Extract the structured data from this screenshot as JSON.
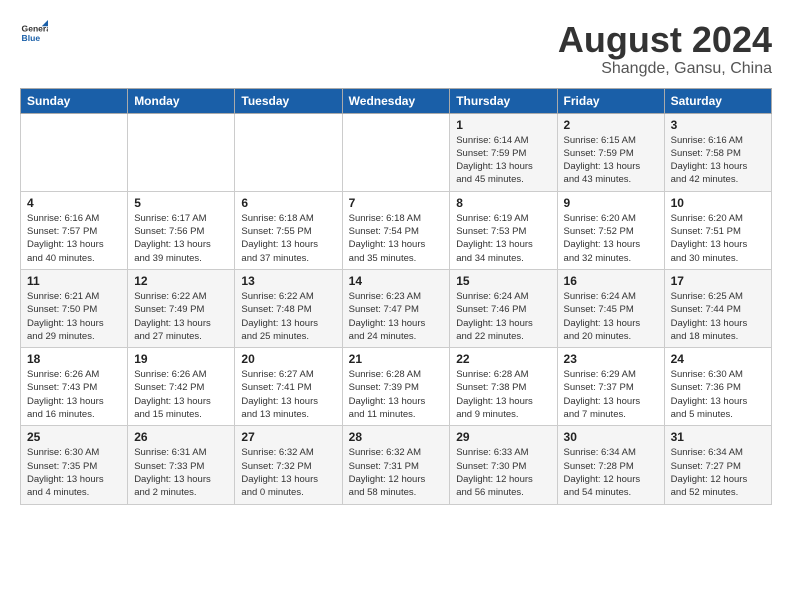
{
  "header": {
    "logo_line1": "General",
    "logo_line2": "Blue",
    "title": "August 2024",
    "subtitle": "Shangde, Gansu, China"
  },
  "days_of_week": [
    "Sunday",
    "Monday",
    "Tuesday",
    "Wednesday",
    "Thursday",
    "Friday",
    "Saturday"
  ],
  "weeks": [
    [
      {
        "day": "",
        "info": ""
      },
      {
        "day": "",
        "info": ""
      },
      {
        "day": "",
        "info": ""
      },
      {
        "day": "",
        "info": ""
      },
      {
        "day": "1",
        "info": "Sunrise: 6:14 AM\nSunset: 7:59 PM\nDaylight: 13 hours\nand 45 minutes."
      },
      {
        "day": "2",
        "info": "Sunrise: 6:15 AM\nSunset: 7:59 PM\nDaylight: 13 hours\nand 43 minutes."
      },
      {
        "day": "3",
        "info": "Sunrise: 6:16 AM\nSunset: 7:58 PM\nDaylight: 13 hours\nand 42 minutes."
      }
    ],
    [
      {
        "day": "4",
        "info": "Sunrise: 6:16 AM\nSunset: 7:57 PM\nDaylight: 13 hours\nand 40 minutes."
      },
      {
        "day": "5",
        "info": "Sunrise: 6:17 AM\nSunset: 7:56 PM\nDaylight: 13 hours\nand 39 minutes."
      },
      {
        "day": "6",
        "info": "Sunrise: 6:18 AM\nSunset: 7:55 PM\nDaylight: 13 hours\nand 37 minutes."
      },
      {
        "day": "7",
        "info": "Sunrise: 6:18 AM\nSunset: 7:54 PM\nDaylight: 13 hours\nand 35 minutes."
      },
      {
        "day": "8",
        "info": "Sunrise: 6:19 AM\nSunset: 7:53 PM\nDaylight: 13 hours\nand 34 minutes."
      },
      {
        "day": "9",
        "info": "Sunrise: 6:20 AM\nSunset: 7:52 PM\nDaylight: 13 hours\nand 32 minutes."
      },
      {
        "day": "10",
        "info": "Sunrise: 6:20 AM\nSunset: 7:51 PM\nDaylight: 13 hours\nand 30 minutes."
      }
    ],
    [
      {
        "day": "11",
        "info": "Sunrise: 6:21 AM\nSunset: 7:50 PM\nDaylight: 13 hours\nand 29 minutes."
      },
      {
        "day": "12",
        "info": "Sunrise: 6:22 AM\nSunset: 7:49 PM\nDaylight: 13 hours\nand 27 minutes."
      },
      {
        "day": "13",
        "info": "Sunrise: 6:22 AM\nSunset: 7:48 PM\nDaylight: 13 hours\nand 25 minutes."
      },
      {
        "day": "14",
        "info": "Sunrise: 6:23 AM\nSunset: 7:47 PM\nDaylight: 13 hours\nand 24 minutes."
      },
      {
        "day": "15",
        "info": "Sunrise: 6:24 AM\nSunset: 7:46 PM\nDaylight: 13 hours\nand 22 minutes."
      },
      {
        "day": "16",
        "info": "Sunrise: 6:24 AM\nSunset: 7:45 PM\nDaylight: 13 hours\nand 20 minutes."
      },
      {
        "day": "17",
        "info": "Sunrise: 6:25 AM\nSunset: 7:44 PM\nDaylight: 13 hours\nand 18 minutes."
      }
    ],
    [
      {
        "day": "18",
        "info": "Sunrise: 6:26 AM\nSunset: 7:43 PM\nDaylight: 13 hours\nand 16 minutes."
      },
      {
        "day": "19",
        "info": "Sunrise: 6:26 AM\nSunset: 7:42 PM\nDaylight: 13 hours\nand 15 minutes."
      },
      {
        "day": "20",
        "info": "Sunrise: 6:27 AM\nSunset: 7:41 PM\nDaylight: 13 hours\nand 13 minutes."
      },
      {
        "day": "21",
        "info": "Sunrise: 6:28 AM\nSunset: 7:39 PM\nDaylight: 13 hours\nand 11 minutes."
      },
      {
        "day": "22",
        "info": "Sunrise: 6:28 AM\nSunset: 7:38 PM\nDaylight: 13 hours\nand 9 minutes."
      },
      {
        "day": "23",
        "info": "Sunrise: 6:29 AM\nSunset: 7:37 PM\nDaylight: 13 hours\nand 7 minutes."
      },
      {
        "day": "24",
        "info": "Sunrise: 6:30 AM\nSunset: 7:36 PM\nDaylight: 13 hours\nand 5 minutes."
      }
    ],
    [
      {
        "day": "25",
        "info": "Sunrise: 6:30 AM\nSunset: 7:35 PM\nDaylight: 13 hours\nand 4 minutes."
      },
      {
        "day": "26",
        "info": "Sunrise: 6:31 AM\nSunset: 7:33 PM\nDaylight: 13 hours\nand 2 minutes."
      },
      {
        "day": "27",
        "info": "Sunrise: 6:32 AM\nSunset: 7:32 PM\nDaylight: 13 hours\nand 0 minutes."
      },
      {
        "day": "28",
        "info": "Sunrise: 6:32 AM\nSunset: 7:31 PM\nDaylight: 12 hours\nand 58 minutes."
      },
      {
        "day": "29",
        "info": "Sunrise: 6:33 AM\nSunset: 7:30 PM\nDaylight: 12 hours\nand 56 minutes."
      },
      {
        "day": "30",
        "info": "Sunrise: 6:34 AM\nSunset: 7:28 PM\nDaylight: 12 hours\nand 54 minutes."
      },
      {
        "day": "31",
        "info": "Sunrise: 6:34 AM\nSunset: 7:27 PM\nDaylight: 12 hours\nand 52 minutes."
      }
    ]
  ]
}
